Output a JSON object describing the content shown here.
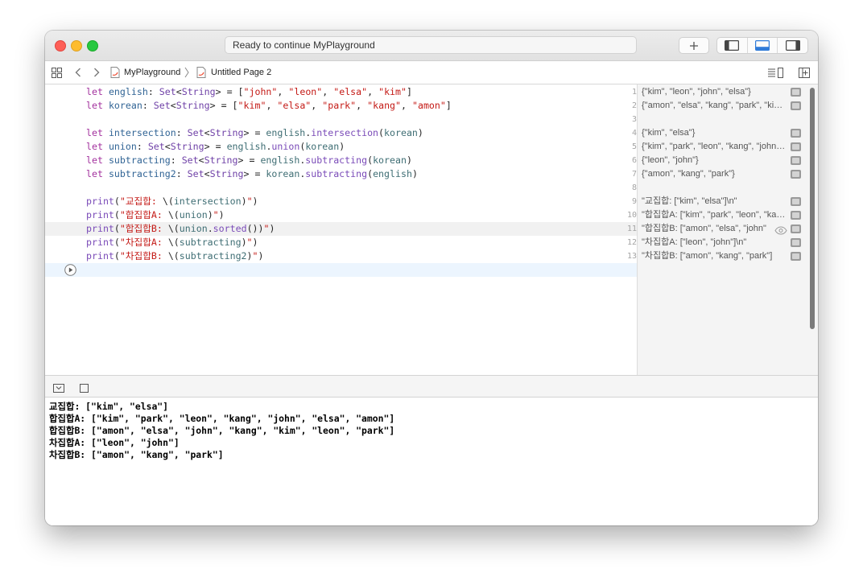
{
  "titlebar": {
    "status": "Ready to continue MyPlayground",
    "add_icon": "plus-icon",
    "layout_icons": [
      "left-panel-icon",
      "bottom-panel-icon",
      "right-panel-icon"
    ],
    "traffic_lights": {
      "close": "#fe5f57",
      "minimize": "#febc2e",
      "zoom": "#28c840"
    }
  },
  "jumpbar": {
    "breadcrumb": [
      "MyPlayground",
      "Untitled Page 2"
    ],
    "icons": [
      "grid-icon",
      "back-arrow-icon",
      "forward-arrow-icon",
      "swift-file-icon",
      "page-icon",
      "editor-options-icon",
      "add-editor-icon"
    ]
  },
  "editor": {
    "line_numbers": [
      "1",
      "2",
      "3",
      "4",
      "5",
      "6",
      "7",
      "8",
      "9",
      "10",
      "11",
      "12",
      "13"
    ],
    "lines": [
      [
        {
          "t": "let",
          "c": "kw"
        },
        {
          "t": " "
        },
        {
          "t": "english",
          "c": "id"
        },
        {
          "t": ": "
        },
        {
          "t": "Set",
          "c": "ty"
        },
        {
          "t": "<"
        },
        {
          "t": "String",
          "c": "ty"
        },
        {
          "t": "> = ["
        },
        {
          "t": "\"john\"",
          "c": "str"
        },
        {
          "t": ", "
        },
        {
          "t": "\"leon\"",
          "c": "str"
        },
        {
          "t": ", "
        },
        {
          "t": "\"elsa\"",
          "c": "str"
        },
        {
          "t": ", "
        },
        {
          "t": "\"kim\"",
          "c": "str"
        },
        {
          "t": "]"
        }
      ],
      [
        {
          "t": "let",
          "c": "kw"
        },
        {
          "t": " "
        },
        {
          "t": "korean",
          "c": "id"
        },
        {
          "t": ": "
        },
        {
          "t": "Set",
          "c": "ty"
        },
        {
          "t": "<"
        },
        {
          "t": "String",
          "c": "ty"
        },
        {
          "t": "> = ["
        },
        {
          "t": "\"kim\"",
          "c": "str"
        },
        {
          "t": ", "
        },
        {
          "t": "\"elsa\"",
          "c": "str"
        },
        {
          "t": ", "
        },
        {
          "t": "\"park\"",
          "c": "str"
        },
        {
          "t": ", "
        },
        {
          "t": "\"kang\"",
          "c": "str"
        },
        {
          "t": ", "
        },
        {
          "t": "\"amon\"",
          "c": "str"
        },
        {
          "t": "]"
        }
      ],
      [],
      [
        {
          "t": "let",
          "c": "kw"
        },
        {
          "t": " "
        },
        {
          "t": "intersection",
          "c": "id"
        },
        {
          "t": ": "
        },
        {
          "t": "Set",
          "c": "ty"
        },
        {
          "t": "<"
        },
        {
          "t": "String",
          "c": "ty"
        },
        {
          "t": "> = "
        },
        {
          "t": "english",
          "c": "pr"
        },
        {
          "t": "."
        },
        {
          "t": "intersection",
          "c": "fn"
        },
        {
          "t": "("
        },
        {
          "t": "korean",
          "c": "pr"
        },
        {
          "t": ")"
        }
      ],
      [
        {
          "t": "let",
          "c": "kw"
        },
        {
          "t": " "
        },
        {
          "t": "union",
          "c": "id"
        },
        {
          "t": ": "
        },
        {
          "t": "Set",
          "c": "ty"
        },
        {
          "t": "<"
        },
        {
          "t": "String",
          "c": "ty"
        },
        {
          "t": "> = "
        },
        {
          "t": "english",
          "c": "pr"
        },
        {
          "t": "."
        },
        {
          "t": "union",
          "c": "fn"
        },
        {
          "t": "("
        },
        {
          "t": "korean",
          "c": "pr"
        },
        {
          "t": ")"
        }
      ],
      [
        {
          "t": "let",
          "c": "kw"
        },
        {
          "t": " "
        },
        {
          "t": "subtracting",
          "c": "id"
        },
        {
          "t": ": "
        },
        {
          "t": "Set",
          "c": "ty"
        },
        {
          "t": "<"
        },
        {
          "t": "String",
          "c": "ty"
        },
        {
          "t": "> = "
        },
        {
          "t": "english",
          "c": "pr"
        },
        {
          "t": "."
        },
        {
          "t": "subtracting",
          "c": "fn"
        },
        {
          "t": "("
        },
        {
          "t": "korean",
          "c": "pr"
        },
        {
          "t": ")"
        }
      ],
      [
        {
          "t": "let",
          "c": "kw"
        },
        {
          "t": " "
        },
        {
          "t": "subtracting2",
          "c": "id"
        },
        {
          "t": ": "
        },
        {
          "t": "Set",
          "c": "ty"
        },
        {
          "t": "<"
        },
        {
          "t": "String",
          "c": "ty"
        },
        {
          "t": "> = "
        },
        {
          "t": "korean",
          "c": "pr"
        },
        {
          "t": "."
        },
        {
          "t": "subtracting",
          "c": "fn"
        },
        {
          "t": "("
        },
        {
          "t": "english",
          "c": "pr"
        },
        {
          "t": ")"
        }
      ],
      [],
      [
        {
          "t": "print",
          "c": "fn"
        },
        {
          "t": "("
        },
        {
          "t": "\"교집합: ",
          "c": "str"
        },
        {
          "t": "\\("
        },
        {
          "t": "intersection",
          "c": "pr"
        },
        {
          "t": ")"
        },
        {
          "t": "\"",
          "c": "str"
        },
        {
          "t": ")"
        }
      ],
      [
        {
          "t": "print",
          "c": "fn"
        },
        {
          "t": "("
        },
        {
          "t": "\"합집합A: ",
          "c": "str"
        },
        {
          "t": "\\("
        },
        {
          "t": "union",
          "c": "pr"
        },
        {
          "t": ")"
        },
        {
          "t": "\"",
          "c": "str"
        },
        {
          "t": ")"
        }
      ],
      [
        {
          "t": "print",
          "c": "fn"
        },
        {
          "t": "("
        },
        {
          "t": "\"합집합B: ",
          "c": "str"
        },
        {
          "t": "\\("
        },
        {
          "t": "union",
          "c": "pr"
        },
        {
          "t": "."
        },
        {
          "t": "sorted",
          "c": "fn"
        },
        {
          "t": "())"
        },
        {
          "t": "\"",
          "c": "str"
        },
        {
          "t": ")"
        }
      ],
      [
        {
          "t": "print",
          "c": "fn"
        },
        {
          "t": "("
        },
        {
          "t": "\"차집합A: ",
          "c": "str"
        },
        {
          "t": "\\("
        },
        {
          "t": "subtracting",
          "c": "pr"
        },
        {
          "t": ")"
        },
        {
          "t": "\"",
          "c": "str"
        },
        {
          "t": ")"
        }
      ],
      [
        {
          "t": "print",
          "c": "fn"
        },
        {
          "t": "("
        },
        {
          "t": "\"차집합B: ",
          "c": "str"
        },
        {
          "t": "\\("
        },
        {
          "t": "subtracting2",
          "c": "pr"
        },
        {
          "t": ")"
        },
        {
          "t": "\"",
          "c": "str"
        },
        {
          "t": ")"
        }
      ]
    ],
    "run_icon": "play-circle-icon"
  },
  "results": [
    {
      "line": 1,
      "text": "{\"kim\", \"leon\", \"john\", \"elsa\"}"
    },
    {
      "line": 2,
      "text": "{\"amon\", \"elsa\", \"kang\", \"park\", \"kim\"}"
    },
    {
      "line": 4,
      "text": "{\"kim\", \"elsa\"}"
    },
    {
      "line": 5,
      "text": "{\"kim\", \"park\", \"leon\", \"kang\", \"john\", \"elsa\", \"amon\"}"
    },
    {
      "line": 6,
      "text": "{\"leon\", \"john\"}"
    },
    {
      "line": 7,
      "text": "{\"amon\", \"kang\", \"park\"}"
    },
    {
      "line": 9,
      "text": "\"교집합: [\"kim\", \"elsa\"]\\n\""
    },
    {
      "line": 10,
      "text": "\"합집합A: [\"kim\", \"park\", \"leon\", \"kang\", \"john\"]"
    },
    {
      "line": 11,
      "text": "\"합집합B: [\"amon\", \"elsa\", \"john\"",
      "eye": true
    },
    {
      "line": 12,
      "text": "\"차집합A: [\"leon\", \"john\"]\\n\""
    },
    {
      "line": 13,
      "text": "\"차집합B: [\"amon\", \"kang\", \"park\"]"
    }
  ],
  "debugbar": {
    "icons": [
      "hide-debug-area-icon",
      "square-icon"
    ]
  },
  "console": [
    "교집합: [\"kim\", \"elsa\"]",
    "합집합A: [\"kim\", \"park\", \"leon\", \"kang\", \"john\", \"elsa\", \"amon\"]",
    "합집합B: [\"amon\", \"elsa\", \"john\", \"kang\", \"kim\", \"leon\", \"park\"]",
    "차집합A: [\"leon\", \"john\"]",
    "차집합B: [\"amon\", \"kang\", \"park\"]"
  ]
}
